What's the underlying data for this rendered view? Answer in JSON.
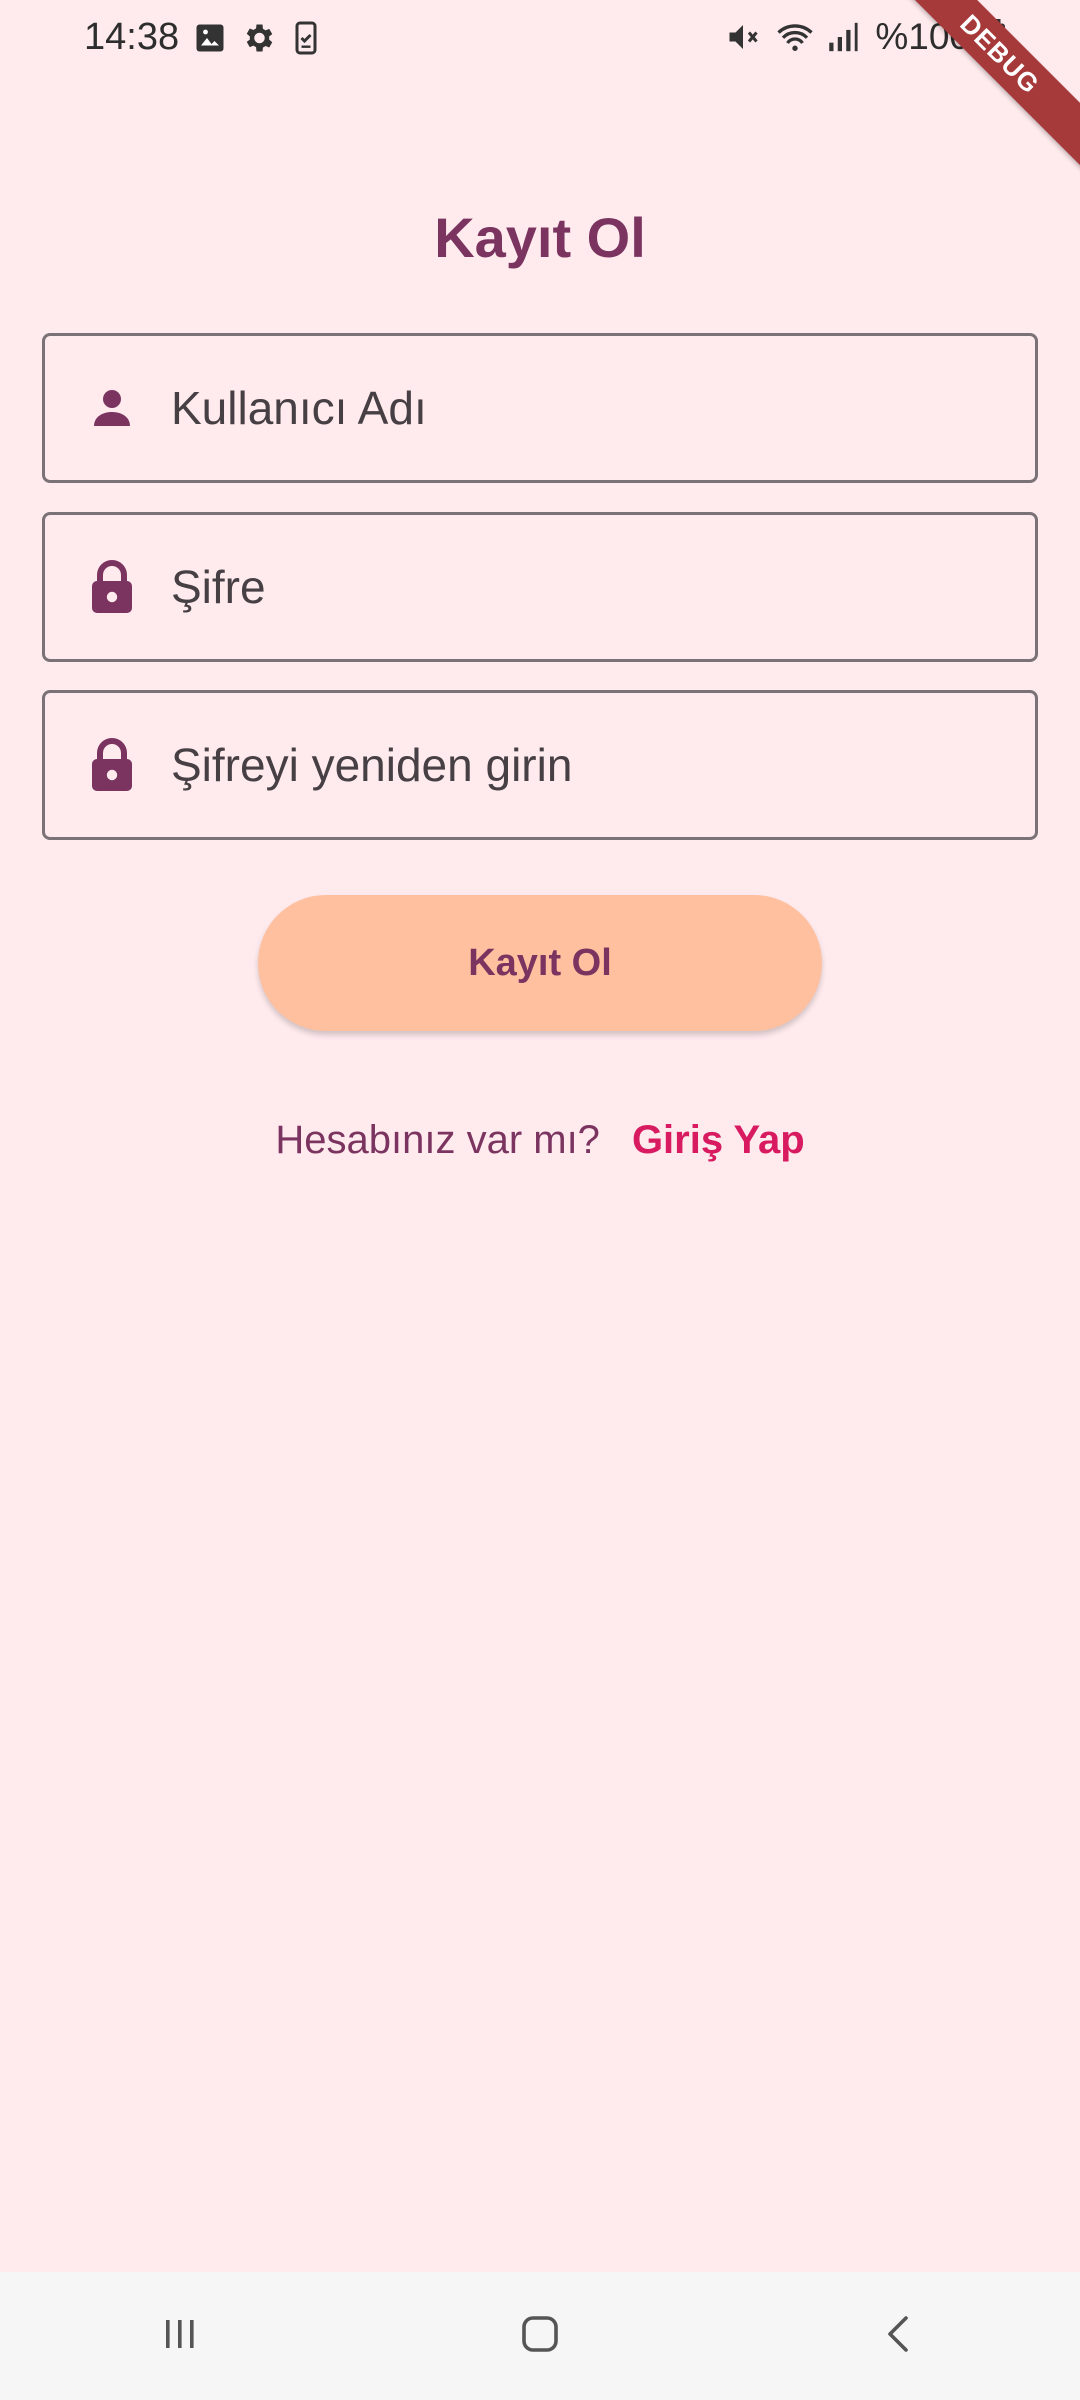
{
  "status_bar": {
    "time": "14:38",
    "battery": "%100",
    "left_icons": [
      "image-icon",
      "gear-icon",
      "clipboard-icon"
    ],
    "right_icons": [
      "mute-icon",
      "wifi-icon",
      "signal-icon",
      "battery-icon"
    ]
  },
  "debug_banner": "DEBUG",
  "page": {
    "title": "Kayıt Ol"
  },
  "form": {
    "username": {
      "placeholder": "Kullanıcı Adı",
      "value": "",
      "icon": "person-icon"
    },
    "password": {
      "placeholder": "Şifre",
      "value": "",
      "icon": "lock-icon"
    },
    "password_confirm": {
      "placeholder": "Şifreyi yeniden girin",
      "value": "",
      "icon": "lock-icon"
    },
    "submit_label": "Kayıt Ol"
  },
  "login_prompt": {
    "question": "Hesabınız var mı?",
    "link_label": "Giriş Yap"
  },
  "nav": {
    "buttons": [
      "recents-icon",
      "home-icon",
      "back-icon"
    ]
  },
  "colors": {
    "background": "#ffebee",
    "primary": "#7b3460",
    "button": "#ffc09f",
    "link": "#d81b60",
    "ribbon": "#a63a3a"
  }
}
